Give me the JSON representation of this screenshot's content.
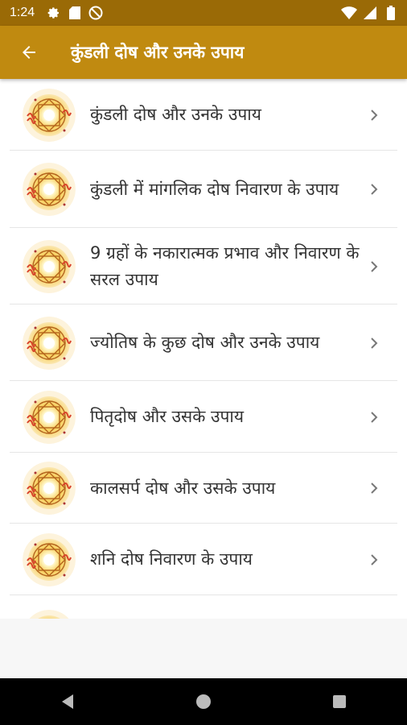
{
  "status_bar": {
    "time": "1:24",
    "icons": [
      "settings-icon",
      "sd-card-icon",
      "do-not-disturb-icon",
      "wifi-icon",
      "signal-icon",
      "battery-icon"
    ]
  },
  "app_bar": {
    "title": "कुंडली दोष और उनके उपाय",
    "back_icon": "arrow-back-icon",
    "color": "#c08a10"
  },
  "list": {
    "items": [
      {
        "label": "कुंडली दोष और उनके उपाय"
      },
      {
        "label": "कुंडली में मांगलिक दोष निवारण के उपाय"
      },
      {
        "label": "9 ग्रहों के नकारात्मक प्रभाव और निवारण के सरल उपाय"
      },
      {
        "label": "ज्योतिष के कुछ दोष और उनके उपाय"
      },
      {
        "label": "पितृदोष और उसके उपाय"
      },
      {
        "label": "कालसर्प दोष और उसके उपाय"
      },
      {
        "label": "शनि दोष निवारण के उपाय"
      }
    ],
    "item_icon": "astrology-wheel-icon",
    "chevron_icon": "chevron-right-icon"
  },
  "nav_bar": {
    "buttons": [
      "back-triangle-icon",
      "home-circle-icon",
      "recents-square-icon"
    ]
  }
}
